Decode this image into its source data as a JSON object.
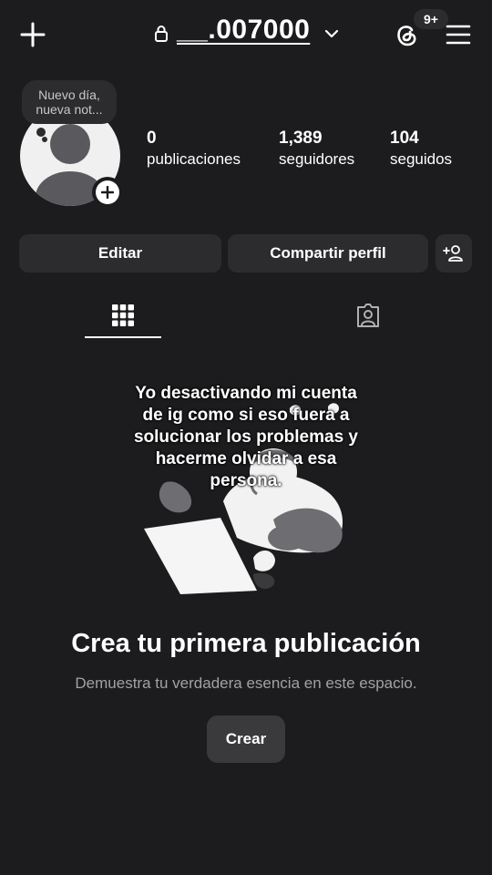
{
  "header": {
    "username": "__.007000",
    "notification_badge": "9+",
    "icons": [
      "plus-icon",
      "lock-icon",
      "chevron-down-icon",
      "threads-icon",
      "hamburger-menu-icon"
    ]
  },
  "profile": {
    "note": "Nuevo día, nueva not...",
    "stats": [
      {
        "value": "0",
        "label": "publicaciones"
      },
      {
        "value": "1,389",
        "label": "seguidores"
      },
      {
        "value": "104",
        "label": "seguidos"
      }
    ]
  },
  "actions": {
    "edit_label": "Editar",
    "share_label": "Compartir perfil",
    "add_person_icon": "add-person-icon"
  },
  "tabs": [
    {
      "name": "grid",
      "icon": "grid-icon",
      "selected": true
    },
    {
      "name": "tagged",
      "icon": "tagged-person-icon",
      "selected": false
    }
  ],
  "overlay": {
    "text": "Yo desactivando mi cuenta de ig como si eso fuera a solucionar los problemas y hacerme olvidar a esa persona."
  },
  "empty_state": {
    "title": "Crea tu primera publicación",
    "subtitle": "Demuestra tu verdadera esencia en este espacio.",
    "button_label": "Crear"
  },
  "colors": {
    "background": "#1c1c1e",
    "surface": "#2c2c2e",
    "text": "#ffffff",
    "muted_text": "#a1a1a6"
  }
}
